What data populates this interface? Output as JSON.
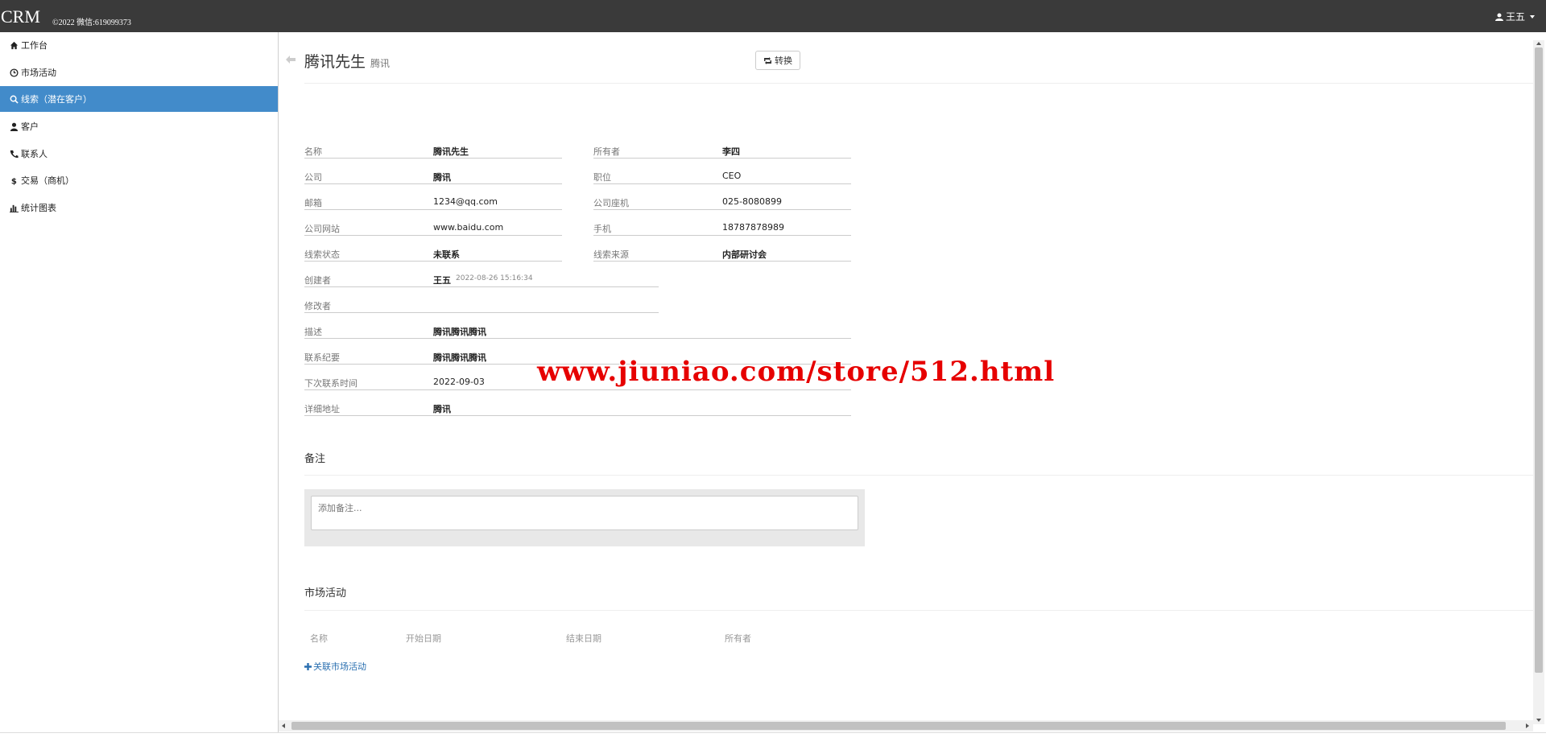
{
  "app": {
    "brand": "CRM",
    "copyright": "©2022 微信:619099373",
    "user": "王五"
  },
  "sidebar": {
    "items": [
      {
        "label": "工作台",
        "icon": "home-icon"
      },
      {
        "label": "市场活动",
        "icon": "clock-icon"
      },
      {
        "label": "线索（潜在客户）",
        "icon": "search-icon",
        "active": true
      },
      {
        "label": "客户",
        "icon": "user-icon"
      },
      {
        "label": "联系人",
        "icon": "phone-icon"
      },
      {
        "label": "交易（商机）",
        "icon": "dollar-icon"
      },
      {
        "label": "统计图表",
        "icon": "bar-chart-icon"
      }
    ]
  },
  "header": {
    "title": "腾讯先生",
    "subtitle": "腾讯",
    "convert_label": "转换"
  },
  "fields": {
    "name": {
      "label": "名称",
      "value": "腾讯先生"
    },
    "owner": {
      "label": "所有者",
      "value": "李四"
    },
    "company": {
      "label": "公司",
      "value": "腾讯"
    },
    "position": {
      "label": "职位",
      "value": "CEO"
    },
    "email": {
      "label": "邮箱",
      "value": "1234@qq.com"
    },
    "phone": {
      "label": "公司座机",
      "value": "025-8080899"
    },
    "website": {
      "label": "公司网站",
      "value": "www.baidu.com"
    },
    "mobile": {
      "label": "手机",
      "value": "18787878989"
    },
    "state": {
      "label": "线索状态",
      "value": "未联系"
    },
    "source": {
      "label": "线索来源",
      "value": "内部研讨会"
    },
    "creator": {
      "label": "创建者",
      "value": "王五",
      "time": "2022-08-26 15:16:34"
    },
    "editor": {
      "label": "修改者",
      "value": "",
      "time": ""
    },
    "description": {
      "label": "描述",
      "value": "腾讯腾讯腾讯"
    },
    "summary": {
      "label": "联系纪要",
      "value": "腾讯腾讯腾讯"
    },
    "next_contact": {
      "label": "下次联系时间",
      "value": "2022-09-03"
    },
    "address": {
      "label": "详细地址",
      "value": "腾讯"
    }
  },
  "remarks": {
    "title": "备注",
    "placeholder": "添加备注..."
  },
  "activities": {
    "title": "市场活动",
    "columns": [
      "名称",
      "开始日期",
      "结束日期",
      "所有者"
    ],
    "link_label": "关联市场活动"
  },
  "watermark": "www.jiuniao.com/store/512.html",
  "colors": {
    "topbar": "#3a3a3a",
    "active_nav": "#428bca",
    "link": "#2a6fb0",
    "watermark": "#e60000"
  }
}
